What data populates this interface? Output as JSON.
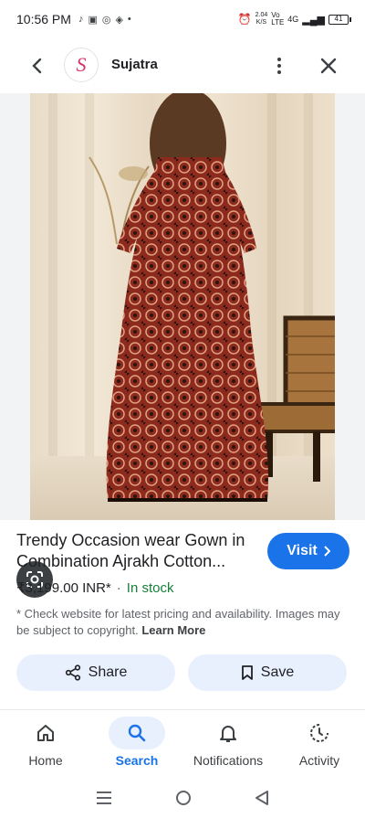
{
  "status_bar": {
    "time": "10:56 PM",
    "speed_value": "2.04",
    "speed_unit": "K/S",
    "network": "Vo LTE",
    "signal": "4G",
    "battery": "41"
  },
  "header": {
    "site_name": "Sujatra",
    "logo_letter": "S"
  },
  "product": {
    "title": "Trendy Occasion wear Gown in Combination Ajrakh Cotton...",
    "price": "₹3,199.00 INR*",
    "separator": "·",
    "stock": "In stock",
    "disclaimer": "* Check website for latest pricing and availability. Images may be subject to copyright.",
    "learn_more": "Learn More"
  },
  "actions": {
    "visit_label": "Visit",
    "share_label": "Share",
    "save_label": "Save"
  },
  "bottom_nav": {
    "home": "Home",
    "search": "Search",
    "notifications": "Notifications",
    "activity": "Activity"
  },
  "colors": {
    "accent": "#1a73e8",
    "stock_green": "#188038",
    "pill_bg": "#e8f0fe"
  }
}
